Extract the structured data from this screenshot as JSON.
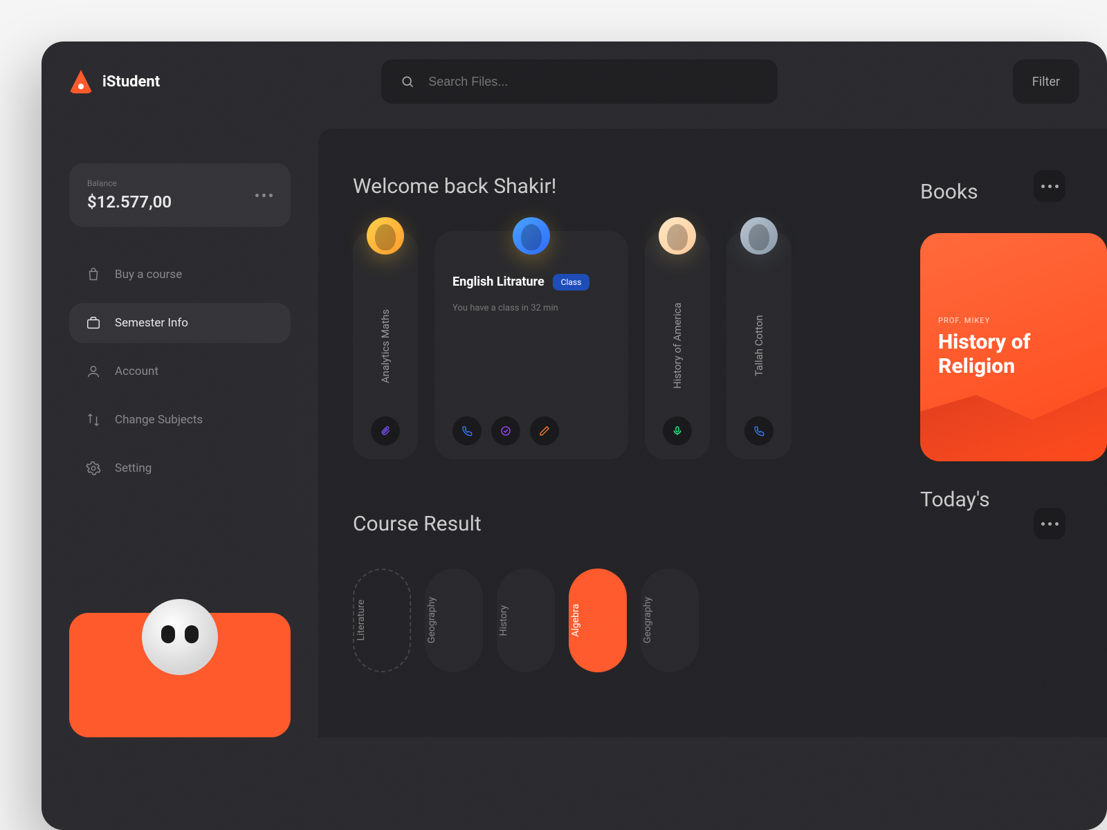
{
  "app": {
    "name": "iStudent"
  },
  "search": {
    "placeholder": "Search Files..."
  },
  "filter": {
    "label": "Filter"
  },
  "balance": {
    "label": "Balance",
    "value": "$12.577,00"
  },
  "nav": {
    "buy": "Buy a course",
    "semester": "Semester Info",
    "account": "Account",
    "change": "Change Subjects",
    "setting": "Setting"
  },
  "welcome": {
    "title": "Welcome back Shakir!"
  },
  "courses": [
    {
      "title": "Analytics Maths"
    },
    {
      "title": "English Litrature",
      "badge": "Class",
      "sub": "You have a class in 32 min"
    },
    {
      "title": "History of America"
    },
    {
      "title": "Tallah Cotton"
    }
  ],
  "books": {
    "heading": "Books",
    "author": "PROF. MIKEY",
    "title": "History of Religion"
  },
  "results": {
    "heading": "Course Result",
    "items": [
      "Literature",
      "Geography",
      "History",
      "Algebra",
      "Geography"
    ]
  },
  "today": {
    "heading": "Today's"
  }
}
